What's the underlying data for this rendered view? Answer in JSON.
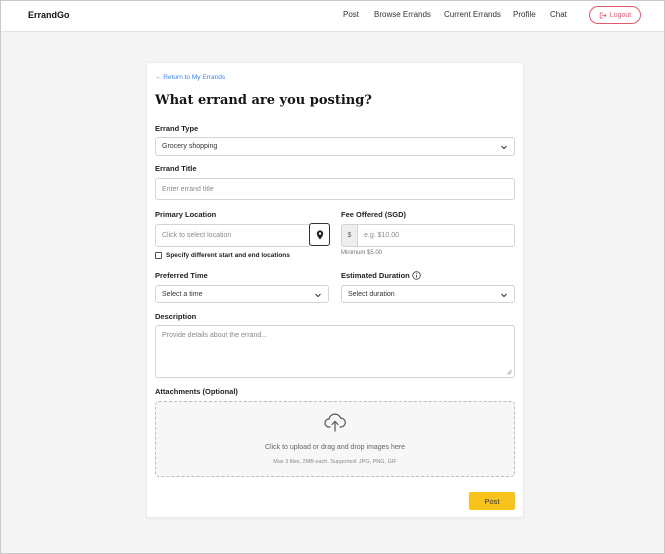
{
  "nav": {
    "brand": "ErrandGo",
    "links": [
      "Post",
      "Browse Errands",
      "Current Errands",
      "Profile",
      "Chat"
    ],
    "logout_label": "Logout"
  },
  "form": {
    "back_link": "← Return to My Errands",
    "title": "What errand are you posting?",
    "errand_type": {
      "label": "Errand Type",
      "value": "Grocery shopping"
    },
    "errand_title": {
      "label": "Errand Title",
      "placeholder": "Enter errand title"
    },
    "primary_location": {
      "label": "Primary Location",
      "placeholder": "Click to select location",
      "checkbox_label": "Specify different start and end locations"
    },
    "fee": {
      "label": "Fee Offered (SGD)",
      "currency": "$",
      "placeholder": "e.g. $10.00",
      "hint": "Minimum $5.00"
    },
    "preferred_time": {
      "label": "Preferred Time",
      "value": "Select a time"
    },
    "duration": {
      "label": "Estimated Duration",
      "value": "Select duration"
    },
    "description": {
      "label": "Description",
      "placeholder": "Provide details about the errand..."
    },
    "attachments": {
      "label": "Attachments (Optional)",
      "main_text": "Click to upload or drag and drop images here",
      "sub_text": "Max 3 files, 2MB each. Supported: JPG, PNG, GIF"
    },
    "submit_label": "Post"
  },
  "colors": {
    "accent_link": "#3b82f6",
    "logout": "#e25a6d",
    "submit": "#f8c21c"
  }
}
